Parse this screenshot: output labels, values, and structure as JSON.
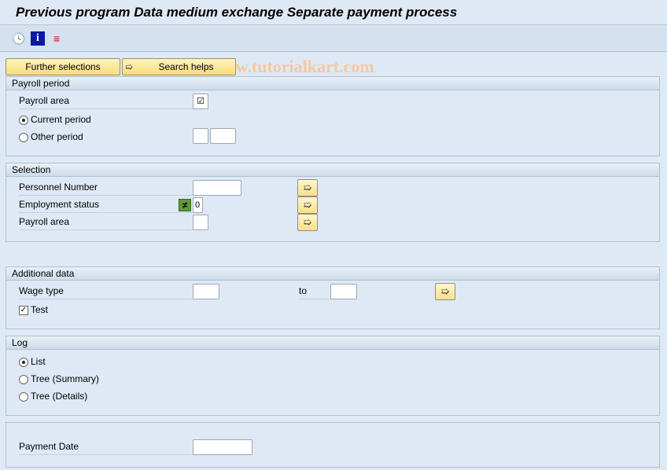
{
  "title": "Previous program Data medium exchange Separate payment process",
  "watermark": "© www.tutorialkart.com",
  "toolbar": {
    "icons": [
      "execute-clock-icon",
      "info-icon",
      "variant-icon"
    ]
  },
  "buttons": {
    "further_selections": "Further selections",
    "search_helps": "Search helps"
  },
  "payroll_period": {
    "header": "Payroll period",
    "payroll_area": "Payroll area",
    "payroll_area_checked": true,
    "current_period": "Current period",
    "other_period": "Other period",
    "selected": "current"
  },
  "selection": {
    "header": "Selection",
    "personnel_number": "Personnel Number",
    "employment_status": "Employment status",
    "employment_status_value": "0",
    "employment_status_op": "≠",
    "payroll_area": "Payroll area"
  },
  "additional": {
    "header": "Additional data",
    "wage_type": "Wage type",
    "to": "to",
    "test": "Test",
    "test_checked": true
  },
  "log": {
    "header": "Log",
    "list": "List",
    "tree_summary": "Tree (Summary)",
    "tree_details": "Tree (Details)",
    "selected": "list"
  },
  "payment": {
    "payment_date": "Payment Date",
    "payment_date_value": ""
  }
}
